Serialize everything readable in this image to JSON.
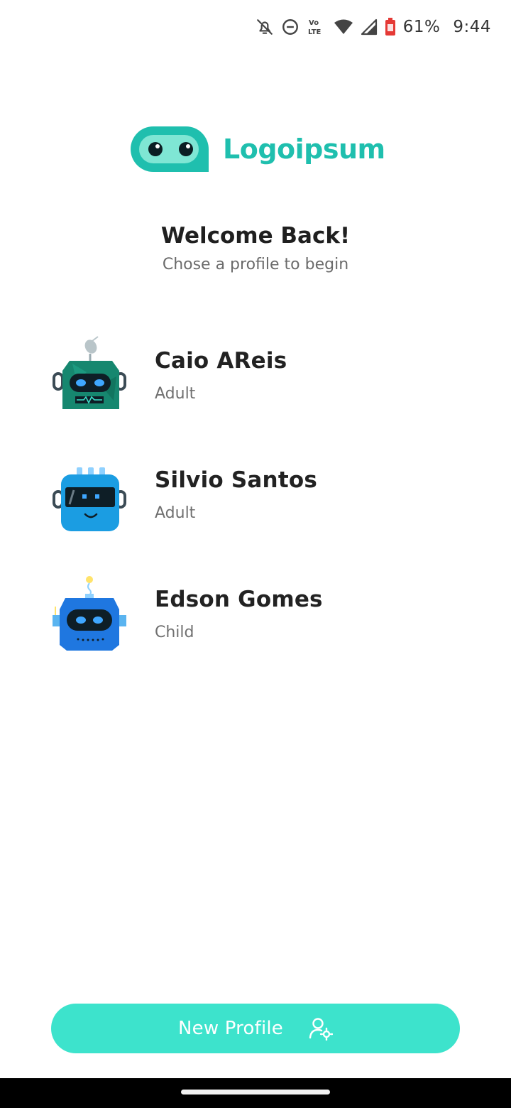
{
  "status_bar": {
    "icons": [
      "bell-off-icon",
      "do-not-disturb-icon",
      "volte-icon",
      "wifi-icon",
      "signal-icon",
      "battery-icon"
    ],
    "volte_line1": "Vo",
    "volte_line2": "LTE",
    "battery_percent": "61%",
    "time": "9:44"
  },
  "logo": {
    "text": "Logoipsum",
    "color": "#1fbfae"
  },
  "welcome": {
    "title": "Welcome Back!",
    "subtitle": "Chose a profile to begin"
  },
  "profiles": [
    {
      "name": "Caio AReis",
      "role": "Adult",
      "avatar": "robot-avatar-green"
    },
    {
      "name": "Silvio Santos",
      "role": "Adult",
      "avatar": "robot-avatar-light-blue"
    },
    {
      "name": "Edson Gomes",
      "role": "Child",
      "avatar": "robot-avatar-blue"
    }
  ],
  "new_profile_button": {
    "label": "New Profile",
    "icon": "user-settings-icon",
    "color": "#3de3cc"
  }
}
